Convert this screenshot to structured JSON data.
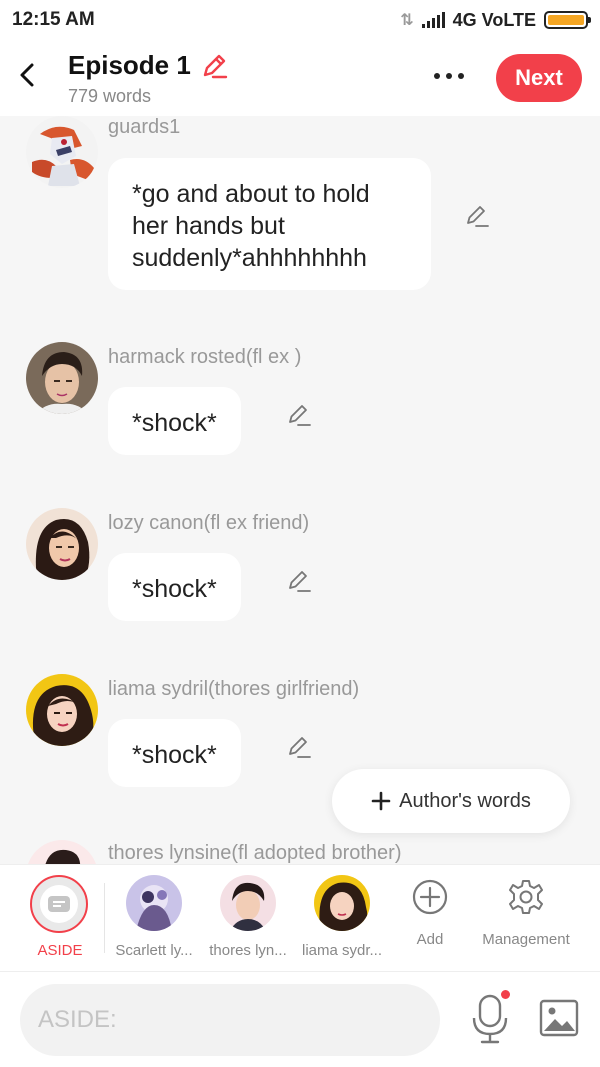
{
  "status_bar": {
    "time": "12:15 AM",
    "network": "4G VoLTE",
    "battery_level": 1.0
  },
  "header": {
    "title": "Episode 1",
    "word_count": "779 words",
    "next_label": "Next"
  },
  "messages": [
    {
      "speaker": "guards1",
      "text": "*go and about to hold her hands but suddenly*ahhhhhhhh"
    },
    {
      "speaker": "harmack rosted(fl ex )",
      "text": "*shock*"
    },
    {
      "speaker": "lozy canon(fl ex friend)",
      "text": "*shock*"
    },
    {
      "speaker": "liama sydril(thores girlfriend)",
      "text": "*shock*"
    },
    {
      "speaker": "thores lynsine(fl adopted brother)",
      "text": ""
    }
  ],
  "authors_words_label": "Author's words",
  "characters": [
    {
      "name": "ASIDE",
      "selected": true
    },
    {
      "name": "Scarlett ly...",
      "selected": false
    },
    {
      "name": "thores lyn...",
      "selected": false
    },
    {
      "name": "liama sydr...",
      "selected": false
    }
  ],
  "add_label": "Add",
  "management_label": "Management",
  "input": {
    "placeholder": "ASIDE:"
  },
  "colors": {
    "accent": "#f2404a",
    "background": "#f6f6f6",
    "bubble": "#ffffff",
    "muted_text": "#999999"
  }
}
